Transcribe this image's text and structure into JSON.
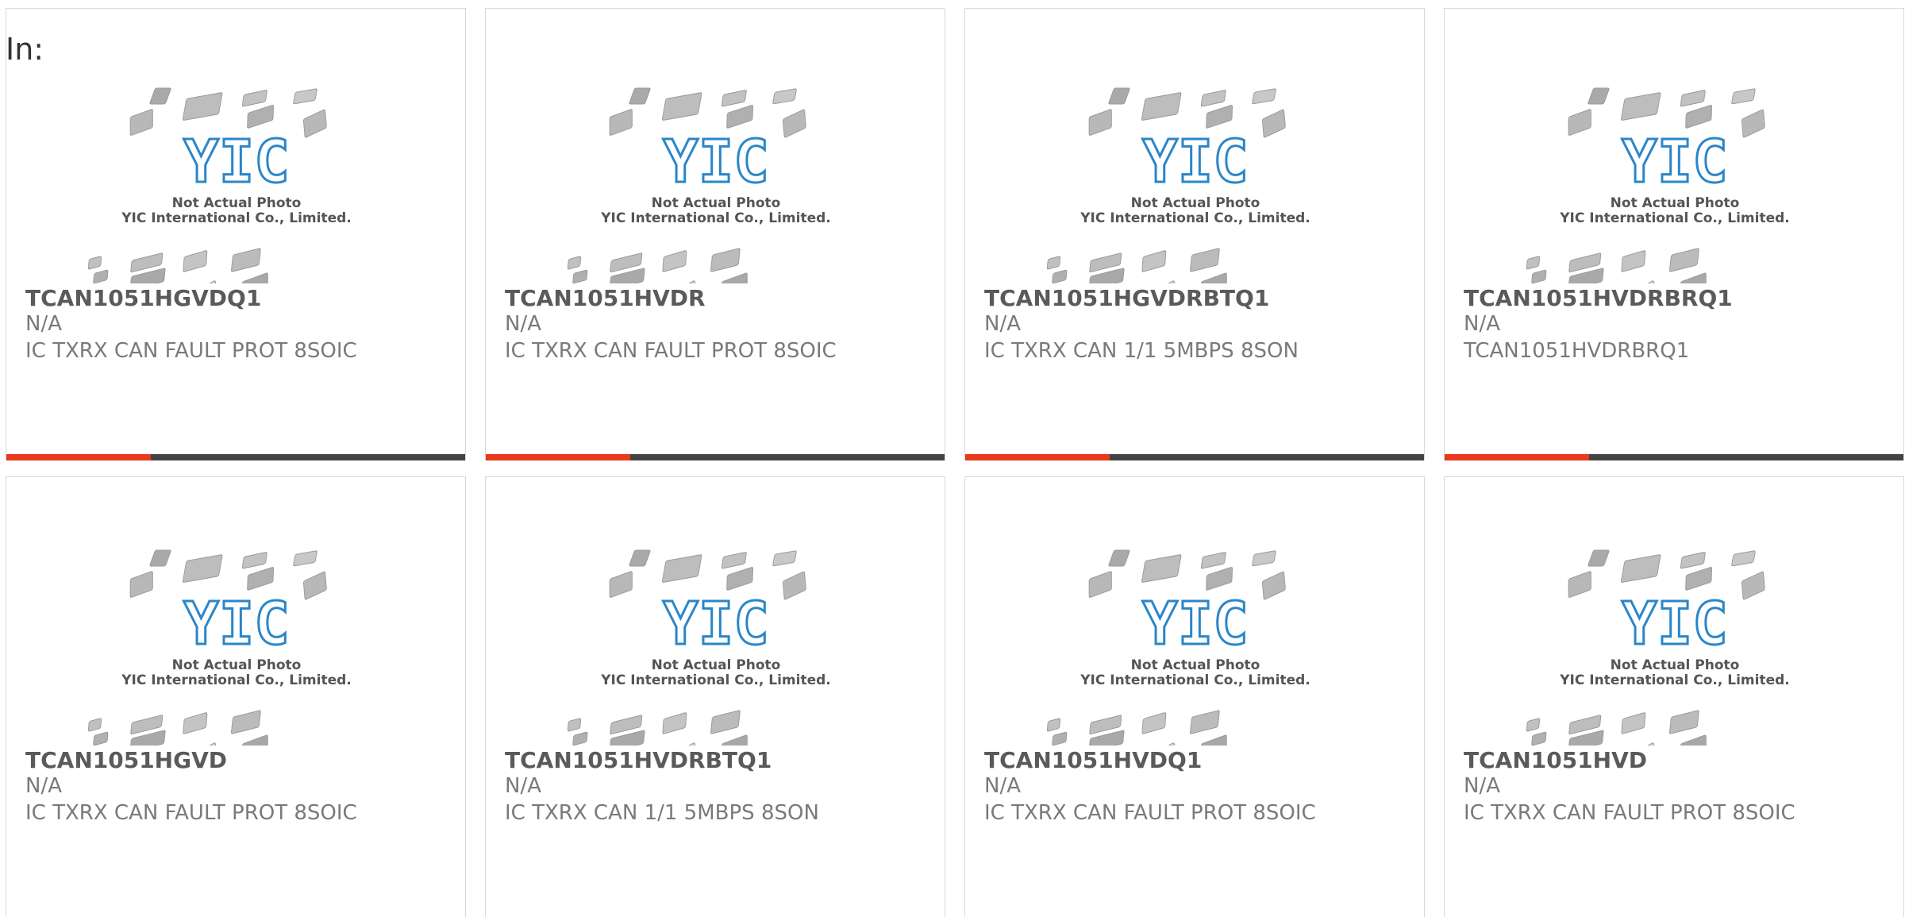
{
  "header": {
    "label": "In:"
  },
  "placeholder_image": {
    "line1": "Not Actual Photo",
    "line2": "YIC International Co., Limited.",
    "logo_text": "YIC",
    "accent_color": "#2a86c8",
    "chip_color": "#b5b5b5"
  },
  "bar_colors": {
    "accent": "#e8391a",
    "base": "#444444"
  },
  "products": [
    {
      "part_number": "TCAN1051HGVDQ1",
      "manufacturer": "N/A",
      "description": "IC TXRX CAN FAULT PROT 8SOIC"
    },
    {
      "part_number": "TCAN1051HVDR",
      "manufacturer": "N/A",
      "description": "IC TXRX CAN FAULT PROT 8SOIC"
    },
    {
      "part_number": "TCAN1051HGVDRBTQ1",
      "manufacturer": "N/A",
      "description": "IC TXRX CAN 1/1 5MBPS 8SON"
    },
    {
      "part_number": "TCAN1051HVDRBRQ1",
      "manufacturer": "N/A",
      "description": "TCAN1051HVDRBRQ1"
    },
    {
      "part_number": "TCAN1051HGVD",
      "manufacturer": "N/A",
      "description": "IC TXRX CAN FAULT PROT 8SOIC"
    },
    {
      "part_number": "TCAN1051HVDRBTQ1",
      "manufacturer": "N/A",
      "description": "IC TXRX CAN 1/1 5MBPS 8SON"
    },
    {
      "part_number": "TCAN1051HVDQ1",
      "manufacturer": "N/A",
      "description": "IC TXRX CAN FAULT PROT 8SOIC"
    },
    {
      "part_number": "TCAN1051HVD",
      "manufacturer": "N/A",
      "description": "IC TXRX CAN FAULT PROT 8SOIC"
    }
  ]
}
